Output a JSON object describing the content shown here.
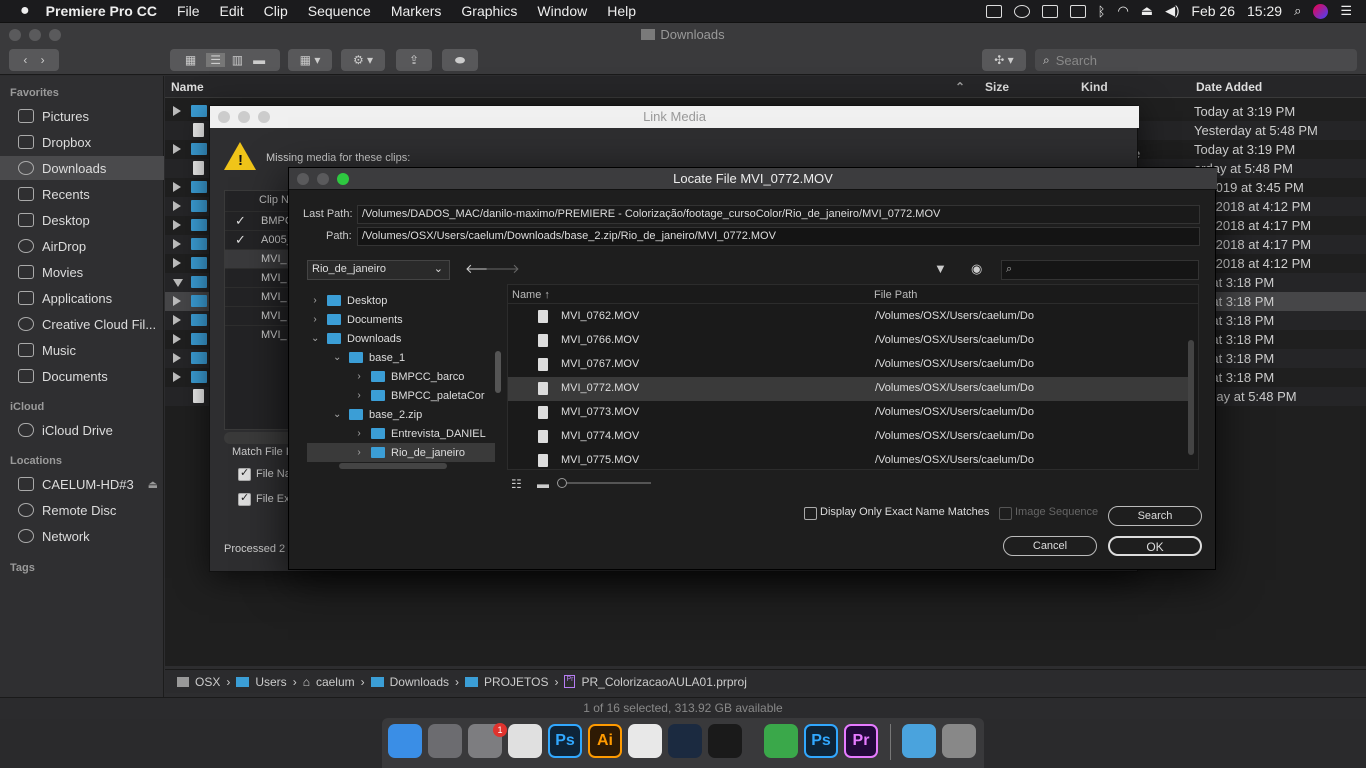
{
  "menubar": {
    "apple": "",
    "app_name": "Premiere Pro CC",
    "items": [
      "File",
      "Edit",
      "Clip",
      "Sequence",
      "Markers",
      "Graphics",
      "Window",
      "Help"
    ],
    "date": "Feb 26",
    "time": "15:29"
  },
  "finder": {
    "title": "Downloads",
    "search_placeholder": "Search",
    "sidebar": {
      "favorites_header": "Favorites",
      "favorites": [
        "Pictures",
        "Dropbox",
        "Downloads",
        "Recents",
        "Desktop",
        "AirDrop",
        "Movies",
        "Applications",
        "Creative Cloud Fil...",
        "Music",
        "Documents"
      ],
      "icloud_header": "iCloud",
      "icloud": [
        "iCloud Drive"
      ],
      "locations_header": "Locations",
      "locations": [
        "CAELUM-HD#3",
        "Remote Disc",
        "Network"
      ],
      "tags_header": "Tags"
    },
    "columns": {
      "name": "Name",
      "size": "Size",
      "kind": "Kind",
      "date_added": "Date Added"
    },
    "dates": [
      "Today at 3:19 PM",
      "Yesterday at 5:48 PM",
      "Today at 3:19 PM",
      "erday at 5:48 PM",
      "2, 2019 at 3:45 PM",
      "26, 2018 at 4:12 PM",
      "26, 2018 at 4:17 PM",
      "26, 2018 at 4:17 PM",
      "26, 2018 at 4:12 PM",
      "ay at 3:18 PM",
      "ay at 3:18 PM",
      "ay at 3:18 PM",
      "ay at 3:18 PM",
      "ay at 3:18 PM",
      "ay at 3:18 PM",
      "terday at 5:48 PM"
    ],
    "partial_kind": "e",
    "path": [
      "OSX",
      "Users",
      "caelum",
      "Downloads",
      "PROJETOS",
      "PR_ColorizacaoAULA01.prproj"
    ],
    "status": "1 of 16 selected, 313.92 GB available"
  },
  "link_media": {
    "title": "Link Media",
    "missing_text": "Missing media for these clips:",
    "clip_header": "Clip N",
    "clips": [
      "BMPC",
      "A005_",
      "MVI_",
      "MVI_",
      "MVI_",
      "MVI_",
      "MVI_"
    ],
    "match_label": "Match File I",
    "opt1": "File Na",
    "opt2": "File Ex",
    "processed": "Processed 2 c"
  },
  "locate": {
    "title": "Locate File MVI_0772.MOV",
    "last_path_label": "Last Path:",
    "last_path": "/Volumes/DADOS_MAC/danilo-maximo/PREMIERE - Colorização/footage_cursoColor/Rio_de_janeiro/MVI_0772.MOV",
    "path_label": "Path:",
    "path": "/Volumes/OSX/Users/caelum/Downloads/base_2.zip/Rio_de_janeiro/MVI_0772.MOV",
    "folder_select": "Rio_de_janeiro",
    "tree": [
      {
        "label": "Desktop",
        "indent": 0,
        "arrow": "›"
      },
      {
        "label": "Documents",
        "indent": 0,
        "arrow": "›"
      },
      {
        "label": "Downloads",
        "indent": 0,
        "arrow": "⌄"
      },
      {
        "label": "base_1",
        "indent": 1,
        "arrow": "⌄"
      },
      {
        "label": "BMPCC_barco",
        "indent": 2,
        "arrow": "›"
      },
      {
        "label": "BMPCC_paletaCor",
        "indent": 2,
        "arrow": "›"
      },
      {
        "label": "base_2.zip",
        "indent": 1,
        "arrow": "⌄"
      },
      {
        "label": "Entrevista_DANIEL",
        "indent": 2,
        "arrow": "›"
      },
      {
        "label": "Rio_de_janeiro",
        "indent": 2,
        "arrow": "›"
      }
    ],
    "list_header_name": "Name",
    "list_header_path": "File Path",
    "files": [
      {
        "name": "MVI_0762.MOV",
        "path": "/Volumes/OSX/Users/caelum/Do"
      },
      {
        "name": "MVI_0766.MOV",
        "path": "/Volumes/OSX/Users/caelum/Do"
      },
      {
        "name": "MVI_0767.MOV",
        "path": "/Volumes/OSX/Users/caelum/Do"
      },
      {
        "name": "MVI_0772.MOV",
        "path": "/Volumes/OSX/Users/caelum/Do"
      },
      {
        "name": "MVI_0773.MOV",
        "path": "/Volumes/OSX/Users/caelum/Do"
      },
      {
        "name": "MVI_0774.MOV",
        "path": "/Volumes/OSX/Users/caelum/Do"
      },
      {
        "name": "MVI_0775.MOV",
        "path": "/Volumes/OSX/Users/caelum/Do"
      }
    ],
    "exact_match": "Display Only Exact Name Matches",
    "image_sequence": "Image Sequence",
    "search_btn": "Search",
    "cancel_btn": "Cancel",
    "ok_btn": "OK"
  },
  "dock": {
    "badge": "1",
    "apps": [
      {
        "name": "finder-app-icon",
        "label": "",
        "color": "#3a8ee6"
      },
      {
        "name": "launchpad-app-icon",
        "label": "",
        "color": "#6c6c70"
      },
      {
        "name": "system-preferences-app-icon",
        "label": "",
        "color": "#7d7d80"
      },
      {
        "name": "chrome-app-icon",
        "label": "",
        "color": "#e0e0e0"
      },
      {
        "name": "photoshop-app-icon",
        "label": "Ps",
        "color": "#0e2438"
      },
      {
        "name": "illustrator-app-icon",
        "label": "Ai",
        "color": "#2e1a04"
      },
      {
        "name": "textedit-app-icon",
        "label": "",
        "color": "#e8e8e8"
      },
      {
        "name": "steam-app-icon",
        "label": "",
        "color": "#1b2a40"
      },
      {
        "name": "terminal-app-icon",
        "label": "",
        "color": "#1a1a1a"
      },
      {
        "name": "clipboard-app-icon",
        "label": "",
        "color": "#3aa84a"
      },
      {
        "name": "photoshop-app-icon-2",
        "label": "Ps",
        "color": "#0e2438"
      },
      {
        "name": "premiere-app-icon",
        "label": "Pr",
        "color": "#22093a"
      },
      {
        "name": "downloads-stack-icon",
        "label": "",
        "color": "#4aa3dd"
      },
      {
        "name": "trash-app-icon",
        "label": "",
        "color": "#888"
      }
    ]
  }
}
